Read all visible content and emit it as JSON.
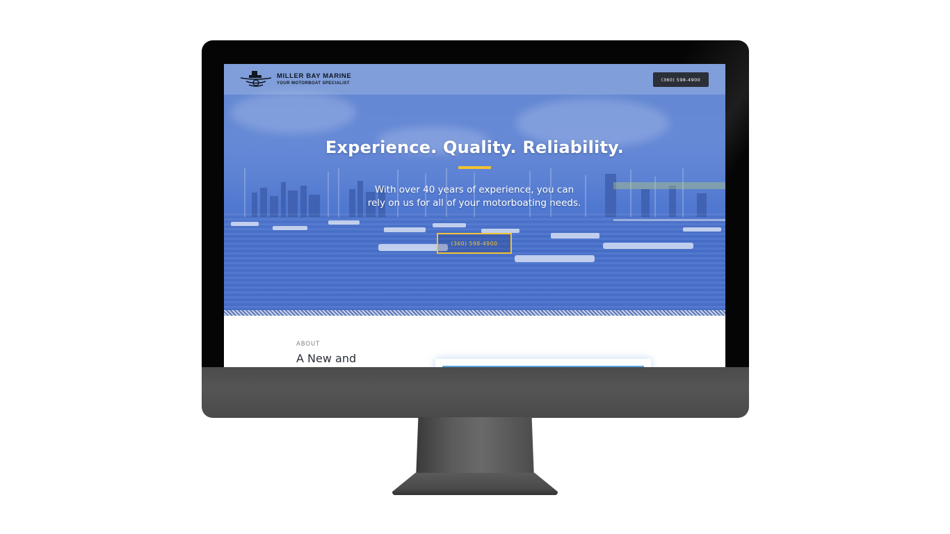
{
  "site": {
    "brand_name": "MILLER BAY MARINE",
    "tagline": "YOUR MOTORBOAT SPECIALIST",
    "header_phone": "(360) 598-4900"
  },
  "hero": {
    "title": "Experience. Quality. Reliability.",
    "subtitle_line1": "With over 40 years of experience, you can",
    "subtitle_line2": "rely on us for all of your motorboating needs.",
    "cta_phone": "(360) 598-4900"
  },
  "about": {
    "eyebrow": "ABOUT",
    "heading": "A New and"
  },
  "colors": {
    "accent_yellow": "#f2c230",
    "header_button": "#2b2f38",
    "hero_blue": "#5b82d6"
  },
  "icons": {
    "logo": "boat-waves-logo-icon"
  }
}
